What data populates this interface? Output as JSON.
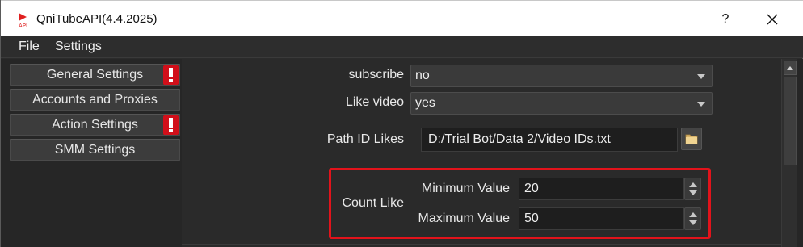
{
  "window": {
    "title": "QniTubeAPI(4.4.2025)",
    "help_label": "?",
    "close_icon": "close-icon",
    "app_icon": "app-logo-icon"
  },
  "menubar": {
    "items": [
      {
        "label": "File"
      },
      {
        "label": "Settings"
      }
    ]
  },
  "nav": {
    "items": [
      {
        "label": "General Settings",
        "alert": true
      },
      {
        "label": "Accounts and Proxies",
        "alert": false
      },
      {
        "label": "Action Settings",
        "alert": true
      },
      {
        "label": "SMM Settings",
        "alert": false
      }
    ],
    "alert_icon": "exclamation-icon",
    "alert_color": "#d10f1a"
  },
  "form": {
    "subscribe": {
      "label": "subscribe",
      "value": "no"
    },
    "like_video": {
      "label": "Like video",
      "value": "yes"
    },
    "path_id_likes": {
      "label": "Path ID Likes",
      "value": "D:/Trial Bot/Data 2/Video IDs.txt",
      "button_icon": "folder-icon"
    },
    "count_like": {
      "label": "Count Like",
      "min_label": "Minimum Value",
      "min_value": "20",
      "max_label": "Maximum Value",
      "max_value": "50"
    }
  },
  "colors": {
    "highlight": "#e2131b",
    "background": "#2a2a2a"
  }
}
